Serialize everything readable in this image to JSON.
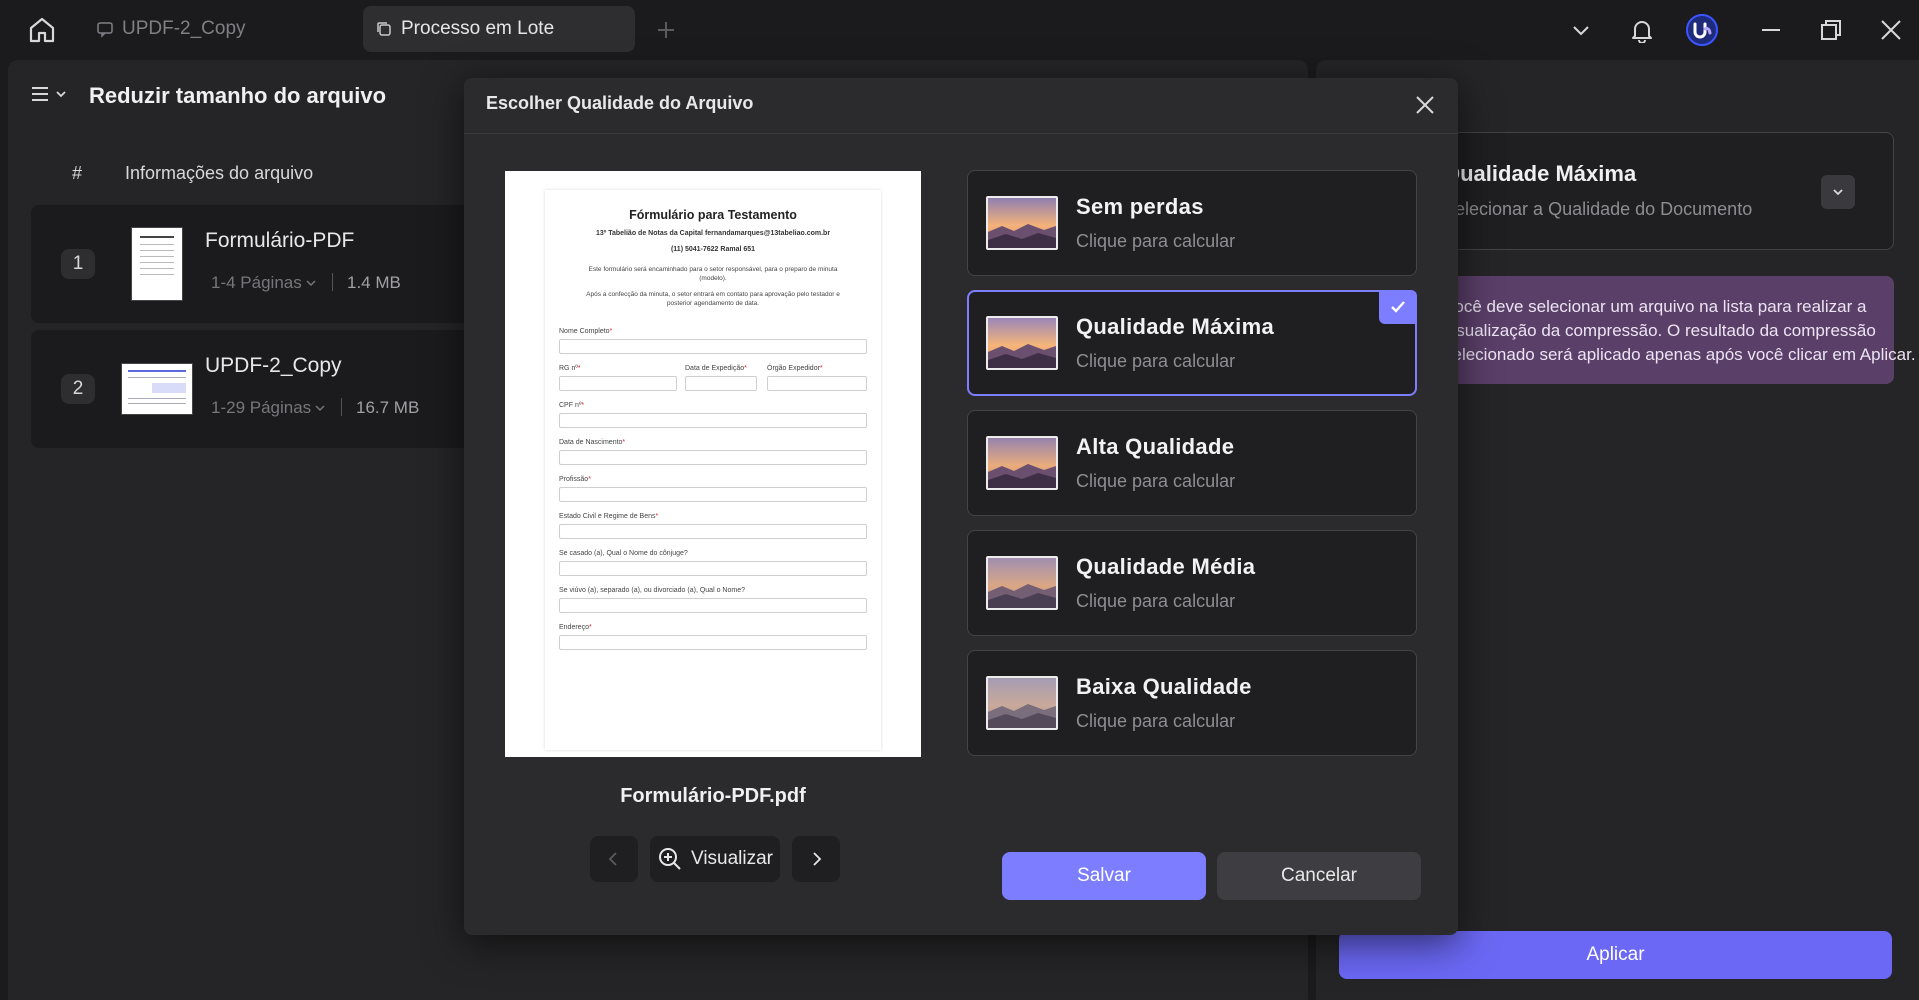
{
  "tabs": [
    {
      "label": "UPDF-2_Copy"
    },
    {
      "label": "Processo em Lote"
    }
  ],
  "left_panel": {
    "title": "Reduzir tamanho do arquivo",
    "col_hash": "#",
    "col_info": "Informações do arquivo",
    "files": [
      {
        "index": "1",
        "name": "Formulário-PDF",
        "pages": "1-4 Páginas",
        "size": "1.4 MB"
      },
      {
        "index": "2",
        "name": "UPDF-2_Copy",
        "pages": "1-29 Páginas",
        "size": "16.7 MB"
      }
    ]
  },
  "right_panel": {
    "quality_title": "Qualidade Máxima",
    "quality_sub": "Selecionar a Qualidade do Documento",
    "info_line1": "Você deve selecionar um arquivo na lista para realizar a",
    "info_line2": "visualização da compressão. O resultado da compressão",
    "info_line3": "selecionado será aplicado apenas após você clicar em Aplicar.",
    "apply_label": "Aplicar"
  },
  "modal": {
    "title": "Escolher Qualidade do Arquivo",
    "filename": "Formulário-PDF.pdf",
    "preview_label": "Visualizar",
    "save_label": "Salvar",
    "cancel_label": "Cancelar",
    "options": [
      {
        "title": "Sem perdas",
        "sub": "Clique para calcular"
      },
      {
        "title": "Qualidade Máxima",
        "sub": "Clique para calcular"
      },
      {
        "title": "Alta Qualidade",
        "sub": "Clique para calcular"
      },
      {
        "title": "Qualidade Média",
        "sub": "Clique para calcular"
      },
      {
        "title": "Baixa Qualidade",
        "sub": "Clique para calcular"
      }
    ],
    "selected_option": "Qualidade Máxima"
  },
  "document": {
    "title": "Fórmulário para Testamento",
    "line1": "13º Tabelião de Notas da Capital   fernandamarques@13tabeliao.com.br",
    "line2": "(11) 5041-7622 Ramal 651",
    "para1a": "Este formulário será encaminhado para o setor responsável, para o preparo de minuta",
    "para1b": "(modelo).",
    "para2a": "Após a confecção da minuta, o setor entrará em contato para aprovação pelo testador e",
    "para2b": "posterior agendamento de data.",
    "fields": {
      "nome": "Nome Completo",
      "rg": "RG nº",
      "data_exp": "Data de Expedição",
      "orgao": "Órgão Expedidor",
      "cpf": "CPF nº",
      "nascimento": "Data de Nascimento",
      "profissao": "Profissão",
      "estado_civil": "Estado Civil e Regime de Bens",
      "conjuge": "Se casado (a), Qual o Nome do cônjuge?",
      "viuvo": "Se viúvo (a), separado (a), ou divorciado (a), Qual o Nome?",
      "endereco": "Endereço"
    }
  },
  "colors": {
    "accent": "#7d7dff",
    "apply": "#6b68f5",
    "info_bg": "#5a3f69"
  }
}
